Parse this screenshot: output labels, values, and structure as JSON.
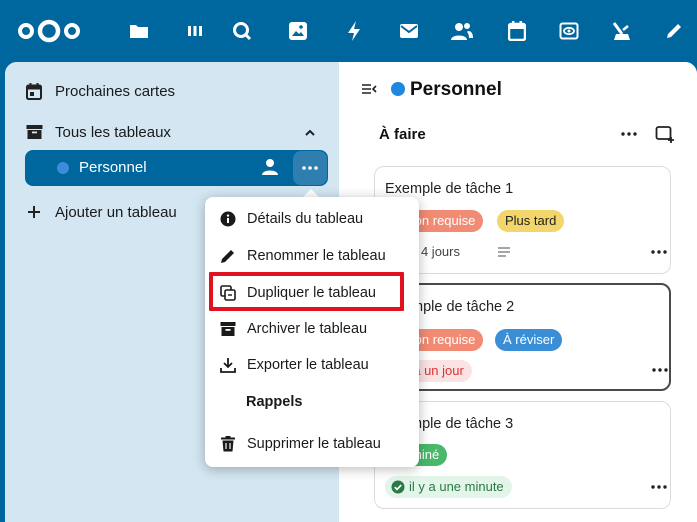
{
  "colors": {
    "brand": "#00679e",
    "sidebar_bg": "#d3e6f2",
    "highlight": "#e0121f"
  },
  "topbar": {
    "apps": [
      "files-icon",
      "deck-icon",
      "search-icon",
      "photos-icon",
      "activity-icon",
      "mail-icon",
      "contacts-icon",
      "calendar-icon",
      "forms-icon",
      "tasks-icon",
      "notes-icon"
    ]
  },
  "sidebar": {
    "upcoming_label": "Prochaines cartes",
    "all_boards_label": "Tous les tableaux",
    "active_board_label": "Personnel",
    "add_board_label": "Ajouter un tableau"
  },
  "main": {
    "board_title": "Personnel",
    "stack_title": "À faire",
    "cards": [
      {
        "title": "Exemple de tâche 1",
        "labels": [
          {
            "text": "Action requise",
            "color": "#f28b74"
          },
          {
            "text": "Plus tard",
            "color": "#f2d66b"
          }
        ],
        "due": "Dans 4 jours"
      },
      {
        "title": "Exemple de tâche 2",
        "labels": [
          {
            "text": "Action requise",
            "color": "#f28b74"
          },
          {
            "text": "À réviser",
            "color": "#3a8ed6"
          }
        ],
        "due": "Il y a un jour"
      },
      {
        "title": "Exemple de tâche 3",
        "labels": [
          {
            "text": "Terminé",
            "color": "#49b86b"
          }
        ],
        "due": "il y a une minute"
      }
    ]
  },
  "popover": {
    "details": "Détails du tableau",
    "rename": "Renommer le tableau",
    "duplicate": "Dupliquer le tableau",
    "archive": "Archiver le tableau",
    "export": "Exporter le tableau",
    "reminders_heading": "Rappels",
    "delete": "Supprimer le tableau"
  }
}
